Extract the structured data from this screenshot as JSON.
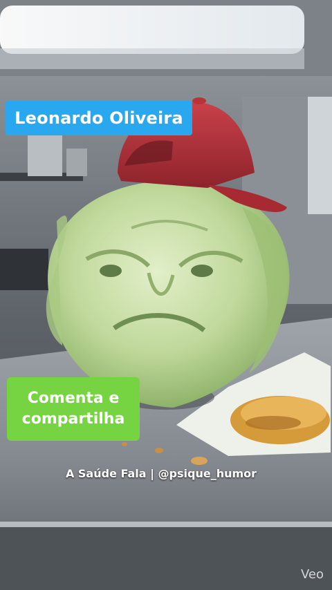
{
  "overlay": {
    "name_tag": "Leonardo Oliveira",
    "cta_line1": "Comenta e",
    "cta_line2": "compartilha",
    "credit": "A Saúde Fala | @psique_humor",
    "watermark": "Veo"
  },
  "colors": {
    "name_tag_bg": "#29a8f0",
    "cta_bg": "#76d341",
    "cap": "#b8333a",
    "lettuce": "#c8dfa6"
  }
}
